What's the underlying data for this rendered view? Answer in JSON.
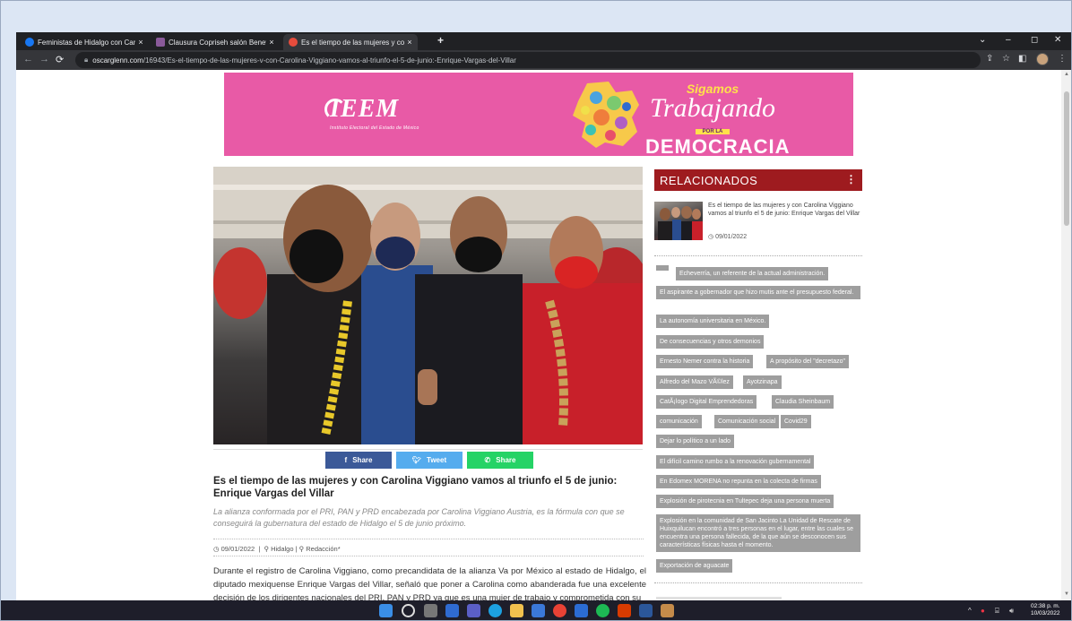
{
  "browser": {
    "tabs": [
      {
        "title": "Feministas de Hidalgo con Carol",
        "favicon_color": "#1877f2",
        "active": false
      },
      {
        "title": "Clausura Copriseh salón Benevel",
        "favicon_color": "#8a5a9a",
        "active": false
      },
      {
        "title": "Es el tiempo de las mujeres y con",
        "favicon_color": "#e74c3c",
        "active": true
      }
    ],
    "new_tab": "+",
    "close_glyph": "×",
    "url_host": "oscarglenn.com",
    "url_path": "/16943/Es-el-tiempo-de-las-mujeres-v-con-Carolina-Viggiano-vamos-al-triunfo-el-5-de-junio:-Enrique-Vargas-del-Villar",
    "window_controls": {
      "dropdown": "⌄",
      "minimize": "–",
      "maximize": "◻",
      "close": "✕"
    }
  },
  "banner": {
    "org_logo": "IEEM",
    "org_name": "Instituto Electoral del Estado de México",
    "slogan_top": "Sigamos",
    "slogan_main": "Trabajando",
    "slogan_small": "POR LA",
    "slogan_bottom": "DEMOCRACIA",
    "colors": {
      "background": "#e85aa6",
      "accent": "#ffe14a"
    }
  },
  "share": {
    "facebook": "Share",
    "twitter": "Tweet",
    "whatsapp": "Share",
    "colors": {
      "facebook": "#3b5998",
      "twitter": "#55acee",
      "whatsapp": "#25d366"
    }
  },
  "article": {
    "title": "Es el tiempo de las mujeres y con Carolina Viggiano vamos al triunfo el 5 de junio: Enrique Vargas del Villar",
    "lead": "La alianza conformada por el PRI, PAN y PRD encabezada por Carolina Viggiano Austria, es la fórmula con que se conseguirá la gubernatura del estado de Hidalgo el 5 de junio próximo.",
    "date": "09/01/2022",
    "section": "Hidalgo",
    "author": "Redacción*",
    "body": "Durante el registro de Carolina Viggiano, como precandidata de la alianza Va por México al estado de Hidalgo, el diputado mexiquense Enrique Vargas del Villar, señaló que poner a Carolina como abanderada fue una excelente decisión de los dirigentes nacionales del PRI, PAN y PRD ya que es una mujer de trabajo y comprometida con su"
  },
  "sidebar": {
    "header": "RELACIONADOS",
    "related": {
      "title": "Es el tiempo de las mujeres y con Carolina Viggiano vamos al triunfo el 5 de junio: Enrique Vargas del Villar",
      "date": "09/01/2022"
    },
    "tags": [
      "Echeverría, un referente de la actual administración.",
      "El aspirante a gobernador que hizo mutis ante el presupuesto federal.",
      "La autonomía universitaria en México.",
      "De consecuencias y otros demonios",
      "Ernesto Nemer contra la historia",
      "A propósito del \"decretazo\"",
      "Alfredo del Mazo VÃ©lez",
      "Ayotzinapa",
      "CatÃ¡logo Digital Emprendedoras",
      "Claudia Sheinbaum",
      "comunicación",
      "Comunicación social",
      "Covid29",
      "Dejar lo político a un lado",
      "El difícil camino rumbo a la renovación gubernamental",
      "En Edomex MORENA no repunta en la colecta de firmas",
      "Explosión de pirotecnia en Tultepec deja una persona muerta",
      "Explosión en la comunidad de San Jacinto La Unidad de Rescate de Huixquilucan encontró a tres personas en el lugar, entre las cuales se encuentra una persona fallecida, de la que aún se desconocen sus características físicas hasta el momento.",
      "Exportación de aguacate"
    ],
    "colors": {
      "header": "#9e1b1f",
      "tag": "#9e9e9e"
    }
  },
  "taskbar": {
    "time": "02:38 p. m.",
    "date": "10/03/2022",
    "tray": "^"
  }
}
